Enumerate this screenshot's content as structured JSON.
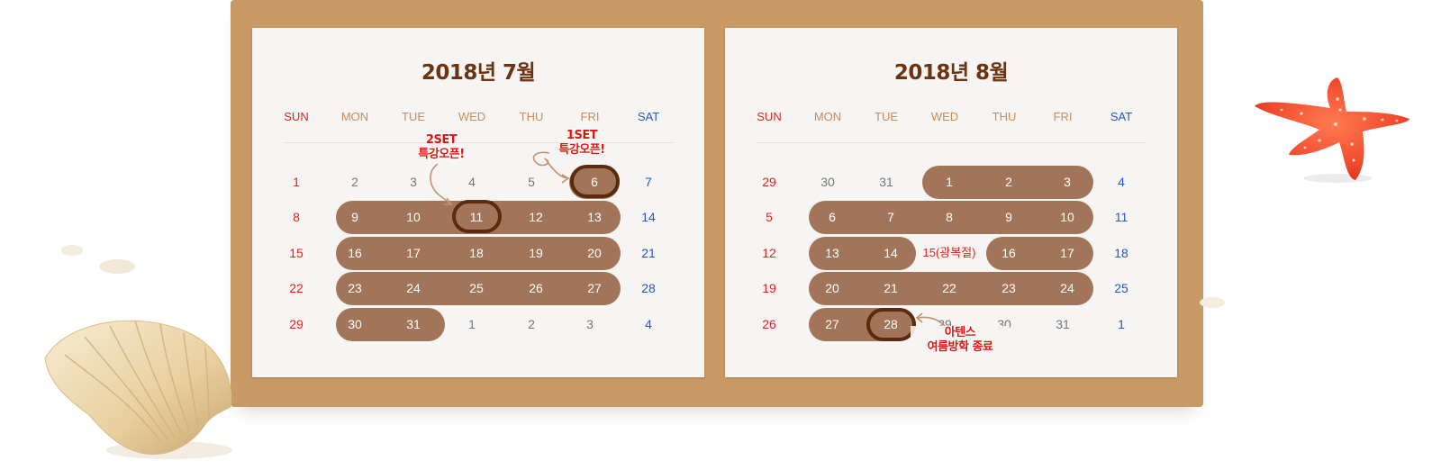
{
  "calendars": [
    {
      "title": "2018년 7월",
      "weekdays": [
        "SUN",
        "MON",
        "TUE",
        "WED",
        "THU",
        "FRI",
        "SAT"
      ],
      "weeks": [
        [
          "1",
          "2",
          "3",
          "4",
          "5",
          "6",
          "7"
        ],
        [
          "8",
          "9",
          "10",
          "11",
          "12",
          "13",
          "14"
        ],
        [
          "15",
          "16",
          "17",
          "18",
          "19",
          "20",
          "21"
        ],
        [
          "22",
          "23",
          "24",
          "25",
          "26",
          "27",
          "28"
        ],
        [
          "29",
          "30",
          "31",
          "1",
          "2",
          "3",
          "4"
        ]
      ],
      "annotations": [
        {
          "label": "2SET\n특강오픈!",
          "target_day": "11"
        },
        {
          "label": "1SET\n특강오픈!",
          "target_day": "6"
        }
      ]
    },
    {
      "title": "2018년 8월",
      "weekdays": [
        "SUN",
        "MON",
        "TUE",
        "WED",
        "THU",
        "FRI",
        "SAT"
      ],
      "weeks": [
        [
          "29",
          "30",
          "31",
          "1",
          "2",
          "3",
          "4"
        ],
        [
          "5",
          "6",
          "7",
          "8",
          "9",
          "10",
          "11"
        ],
        [
          "12",
          "13",
          "14",
          "15(광복절)",
          "16",
          "17",
          "18"
        ],
        [
          "19",
          "20",
          "21",
          "22",
          "23",
          "24",
          "25"
        ],
        [
          "26",
          "27",
          "28",
          "29",
          "30",
          "31",
          "1"
        ]
      ],
      "annotations": [
        {
          "label": "아텐스\n여름방학 종료",
          "target_day": "28"
        }
      ]
    }
  ],
  "colors": {
    "sunday": "#d9261c",
    "weekday_header": "#c88c5a",
    "saturday": "#2357c7",
    "highlight_bar": "#a2755a",
    "ring": "#5c2a0c",
    "annotation": "#e1140f",
    "title": "#6b3310",
    "board": "#c99a66"
  },
  "icons": [
    "starfish-icon",
    "seashell-icon"
  ]
}
